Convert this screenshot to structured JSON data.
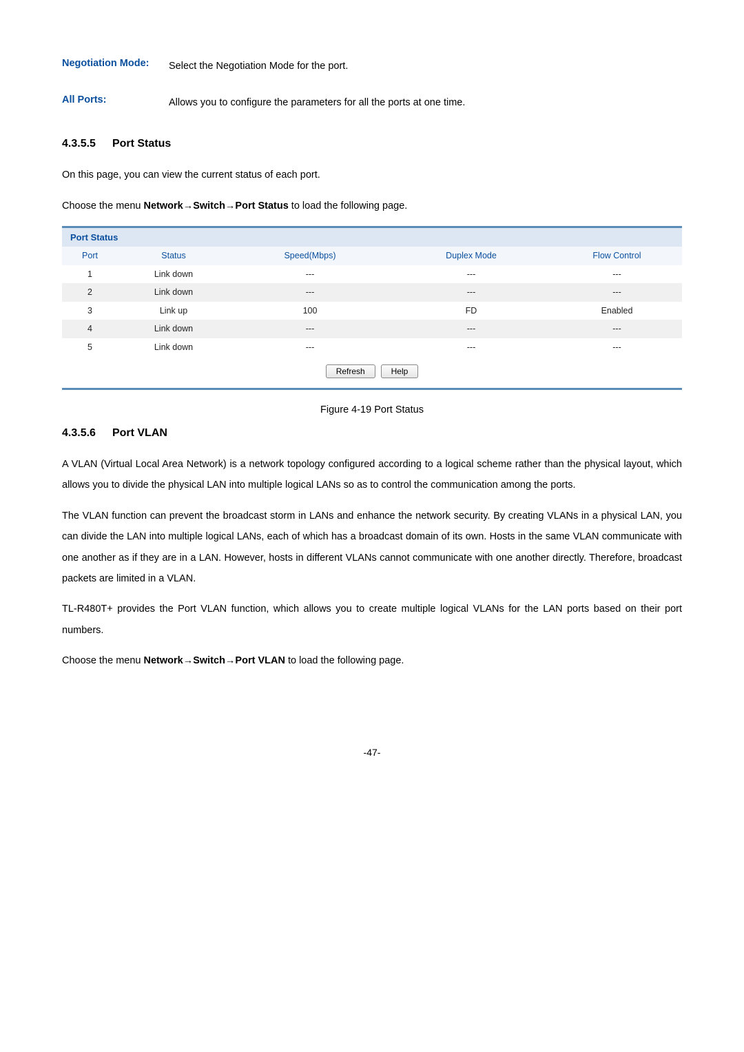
{
  "defs": {
    "neg_mode": {
      "term": "Negotiation Mode:",
      "desc": "Select the Negotiation Mode for the port."
    },
    "all_ports": {
      "term": "All Ports:",
      "desc": "Allows you to configure the parameters for all the ports at one time."
    }
  },
  "sec435_5": {
    "num": "4.3.5.5",
    "title": "Port Status",
    "intro": "On this page, you can view the current status of each port.",
    "nav_prefix": "Choose the menu ",
    "nav_bold": "Network→Switch→Port Status",
    "nav_suffix": " to load the following page."
  },
  "port_status_panel": {
    "title": "Port Status",
    "headers": {
      "port": "Port",
      "status": "Status",
      "speed": "Speed(Mbps)",
      "duplex": "Duplex Mode",
      "flow": "Flow Control"
    },
    "rows": [
      {
        "port": "1",
        "status": "Link down",
        "speed": "---",
        "duplex": "---",
        "flow": "---"
      },
      {
        "port": "2",
        "status": "Link down",
        "speed": "---",
        "duplex": "---",
        "flow": "---"
      },
      {
        "port": "3",
        "status": "Link up",
        "speed": "100",
        "duplex": "FD",
        "flow": "Enabled"
      },
      {
        "port": "4",
        "status": "Link down",
        "speed": "---",
        "duplex": "---",
        "flow": "---"
      },
      {
        "port": "5",
        "status": "Link down",
        "speed": "---",
        "duplex": "---",
        "flow": "---"
      }
    ],
    "buttons": {
      "refresh": "Refresh",
      "help": "Help"
    }
  },
  "caption_419": "Figure 4-19 Port Status",
  "sec435_6": {
    "num": "4.3.5.6",
    "title": "Port VLAN",
    "para1": "A VLAN (Virtual Local Area Network) is a network topology configured according to a logical scheme rather than the physical layout, which allows you to divide the physical LAN into multiple logical LANs so as to control the communication among the ports.",
    "para2": "The VLAN function can prevent the broadcast storm in LANs and enhance the network security. By creating VLANs in a physical LAN, you can divide the LAN into multiple logical LANs, each of which has a broadcast domain of its own. Hosts in the same VLAN communicate with one another as if they are in a LAN. However, hosts in different VLANs cannot communicate with one another directly. Therefore, broadcast packets are limited in a VLAN.",
    "para3": "TL-R480T+ provides the Port VLAN function, which allows you to create multiple logical VLANs for the LAN ports based on their port numbers.",
    "nav_prefix": "Choose the menu ",
    "nav_bold": "Network→Switch→Port VLAN",
    "nav_suffix": " to load the following page."
  },
  "page_num": "-47-"
}
